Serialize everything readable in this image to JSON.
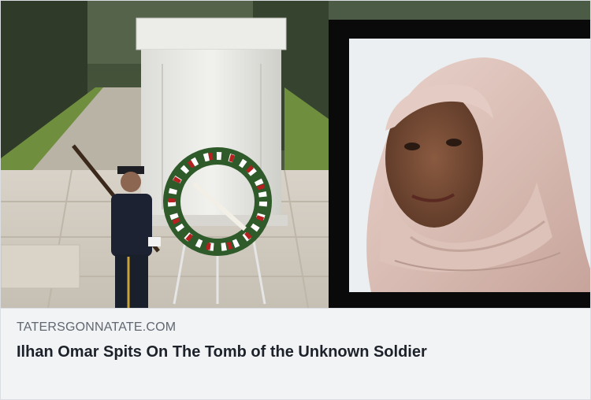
{
  "link_preview": {
    "domain": "TATERSGONNATATE.COM",
    "headline": "Ilhan Omar Spits On The Tomb of the Unknown Soldier"
  },
  "image": {
    "left_scene": "tomb-of-the-unknown-soldier-photo",
    "right_inset": "portrait-photo"
  }
}
